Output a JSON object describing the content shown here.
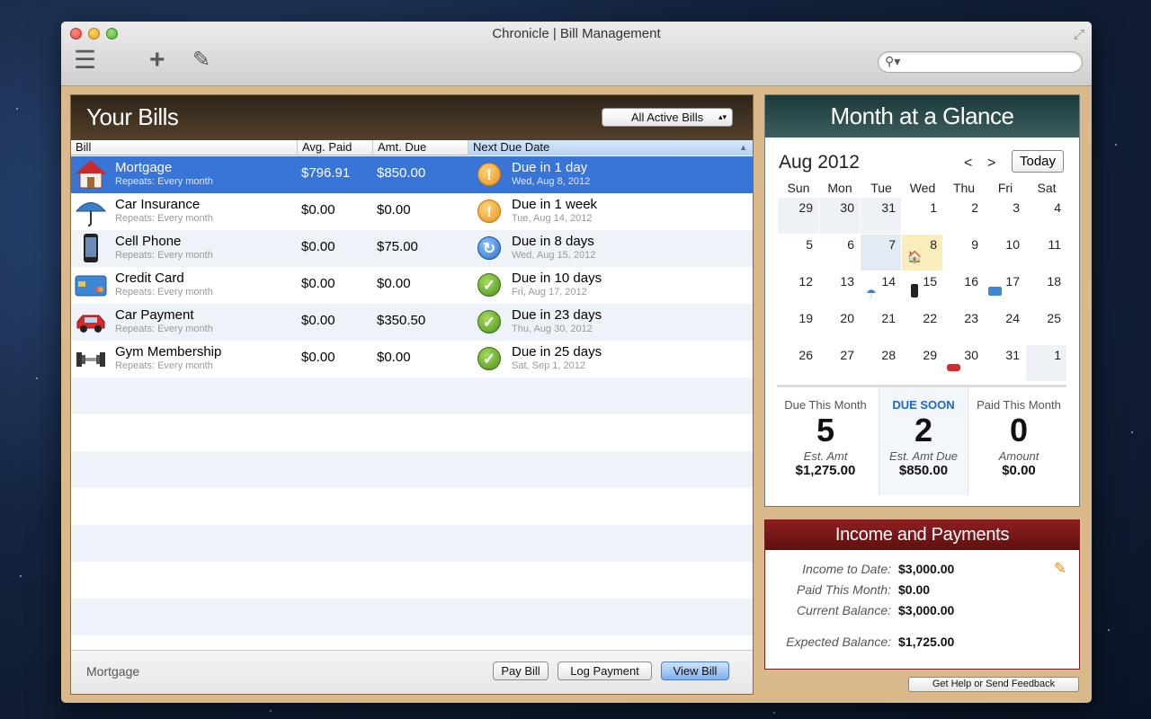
{
  "window": {
    "title": "Chronicle | Bill Management"
  },
  "toolbar": {
    "icons": [
      "list-icon",
      "add-icon",
      "pencil-icon",
      "search-icon",
      "fullscreen-icon"
    ],
    "search_placeholder": ""
  },
  "bills": {
    "title": "Your Bills",
    "filter": "All Active Bills",
    "columns": [
      "Bill",
      "Avg. Paid",
      "Amt. Due",
      "Next Due Date"
    ],
    "rows": [
      {
        "name": "Mortgage",
        "repeat": "Repeats: Every month",
        "avg": "$796.91",
        "amt": "$850.00",
        "due": "Due in 1 day",
        "date": "Wed, Aug 8, 2012",
        "status": "!",
        "icon": "house-icon"
      },
      {
        "name": "Car Insurance",
        "repeat": "Repeats: Every month",
        "avg": "$0.00",
        "amt": "$0.00",
        "due": "Due in 1 week",
        "date": "Tue, Aug 14, 2012",
        "status": "!",
        "icon": "umbrella-icon"
      },
      {
        "name": "Cell Phone",
        "repeat": "Repeats: Every month",
        "avg": "$0.00",
        "amt": "$75.00",
        "due": "Due in 8 days",
        "date": "Wed, Aug 15, 2012",
        "status": "↻",
        "icon": "phone-icon"
      },
      {
        "name": "Credit Card",
        "repeat": "Repeats: Every month",
        "avg": "$0.00",
        "amt": "$0.00",
        "due": "Due in 10 days",
        "date": "Fri, Aug 17, 2012",
        "status": "✓",
        "icon": "credit-card-icon"
      },
      {
        "name": "Car Payment",
        "repeat": "Repeats: Every month",
        "avg": "$0.00",
        "amt": "$350.50",
        "due": "Due in 23 days",
        "date": "Thu, Aug 30, 2012",
        "status": "✓",
        "icon": "car-icon"
      },
      {
        "name": "Gym Membership",
        "repeat": "Repeats: Every month",
        "avg": "$0.00",
        "amt": "$0.00",
        "due": "Due in 25 days",
        "date": "Sat, Sep 1, 2012",
        "status": "✓",
        "icon": "dumbbell-icon"
      }
    ],
    "footer": {
      "selected": "Mortgage",
      "pay": "Pay Bill",
      "log": "Log Payment",
      "view": "View Bill"
    }
  },
  "month": {
    "title": "Month at a Glance",
    "month_label": "Aug 2012",
    "prev": "<",
    "next": ">",
    "today": "Today",
    "weekdays": [
      "Sun",
      "Mon",
      "Tue",
      "Wed",
      "Thu",
      "Fri",
      "Sat"
    ],
    "weeks": [
      [
        "29",
        "30",
        "31",
        "1",
        "2",
        "3",
        "4"
      ],
      [
        "5",
        "6",
        "7",
        "8",
        "9",
        "10",
        "11"
      ],
      [
        "12",
        "13",
        "14",
        "15",
        "16",
        "17",
        "18"
      ],
      [
        "19",
        "20",
        "21",
        "22",
        "23",
        "24",
        "25"
      ],
      [
        "26",
        "27",
        "28",
        "29",
        "30",
        "31",
        "1"
      ]
    ],
    "stats": {
      "due_label": "Due This Month",
      "due_count": "5",
      "due_sub": "Est. Amt",
      "due_amt": "$1,275.00",
      "soon_label": "DUE SOON",
      "soon_count": "2",
      "soon_sub": "Est. Amt Due",
      "soon_amt": "$850.00",
      "paid_label": "Paid This Month",
      "paid_count": "0",
      "paid_sub": "Amount",
      "paid_amt": "$0.00"
    }
  },
  "income": {
    "title": "Income and Payments",
    "rows": [
      {
        "label": "Income to Date:",
        "value": "$3,000.00"
      },
      {
        "label": "Paid This Month:",
        "value": "$0.00"
      },
      {
        "label": "Current Balance:",
        "value": "$3,000.00"
      },
      {
        "label": "Expected Balance:",
        "value": "$1,725.00"
      }
    ]
  },
  "help": "Get Help or Send Feedback",
  "colors": {
    "selection": "#3875d7",
    "due_soon": "#2066c8",
    "warning": "#e8901a",
    "ok": "#4b8f19"
  }
}
